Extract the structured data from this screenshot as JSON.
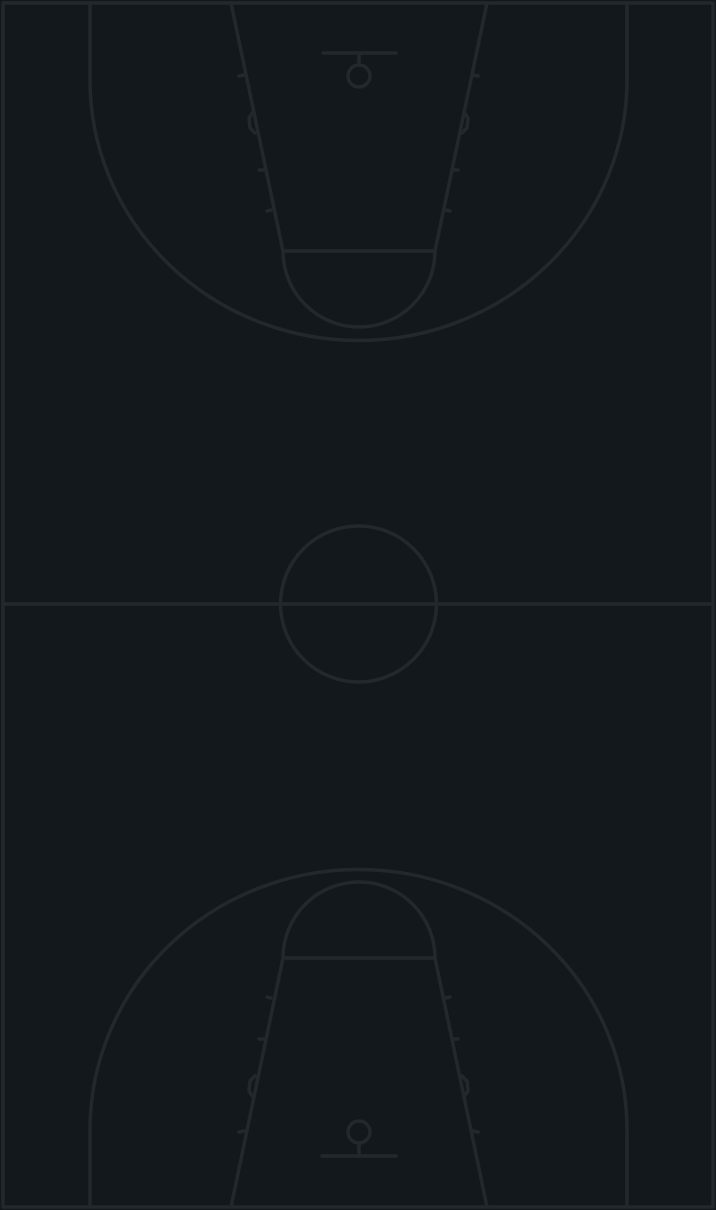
{
  "court": {
    "background_color": "#13181c",
    "line_color": "#23282d",
    "orientation": "vertical",
    "type": "basketball-full-court"
  }
}
